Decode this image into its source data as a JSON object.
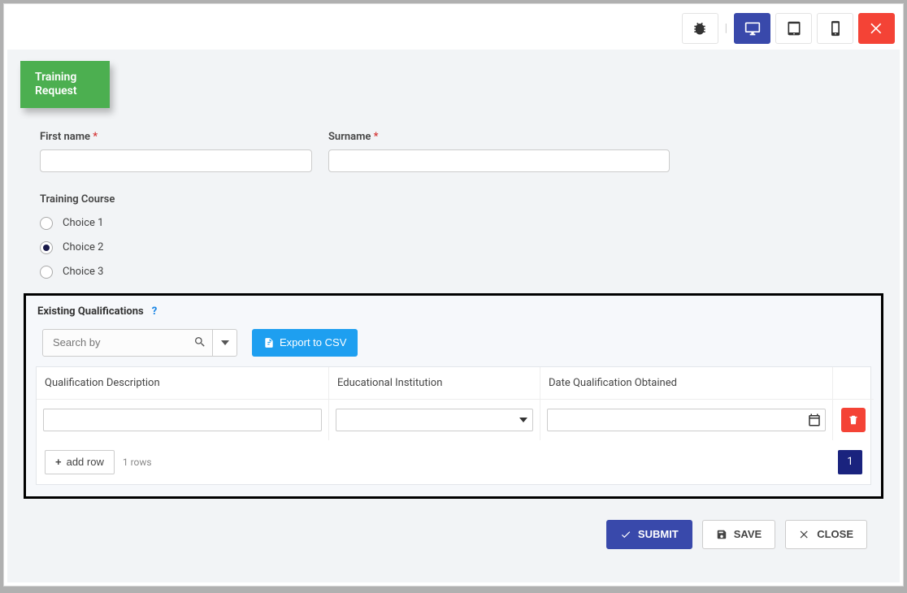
{
  "top": {
    "icons": [
      "bug",
      "desktop",
      "tablet",
      "phone",
      "close"
    ],
    "active_view": "desktop"
  },
  "badge": {
    "line1": "Training",
    "line2": "Request"
  },
  "fields": {
    "first_name": {
      "label": "First name",
      "required": true,
      "value": ""
    },
    "surname": {
      "label": "Surname",
      "required": true,
      "value": ""
    }
  },
  "radio": {
    "label": "Training Course",
    "options": [
      {
        "label": "Choice 1",
        "selected": false
      },
      {
        "label": "Choice 2",
        "selected": true
      },
      {
        "label": "Choice 3",
        "selected": false
      }
    ]
  },
  "panel": {
    "title": "Existing Qualifications",
    "help": "?",
    "search_placeholder": "Search by",
    "export_label": "Export to CSV",
    "columns": [
      "Qualification Description",
      "Educational Institution",
      "Date Qualification Obtained"
    ],
    "rows": [
      {
        "desc": "",
        "inst": "",
        "date": ""
      }
    ],
    "add_row_label": "add row",
    "row_count_label": "1 rows",
    "page_current": "1"
  },
  "actions": {
    "submit": "SUBMIT",
    "save": "SAVE",
    "close": "CLOSE"
  }
}
